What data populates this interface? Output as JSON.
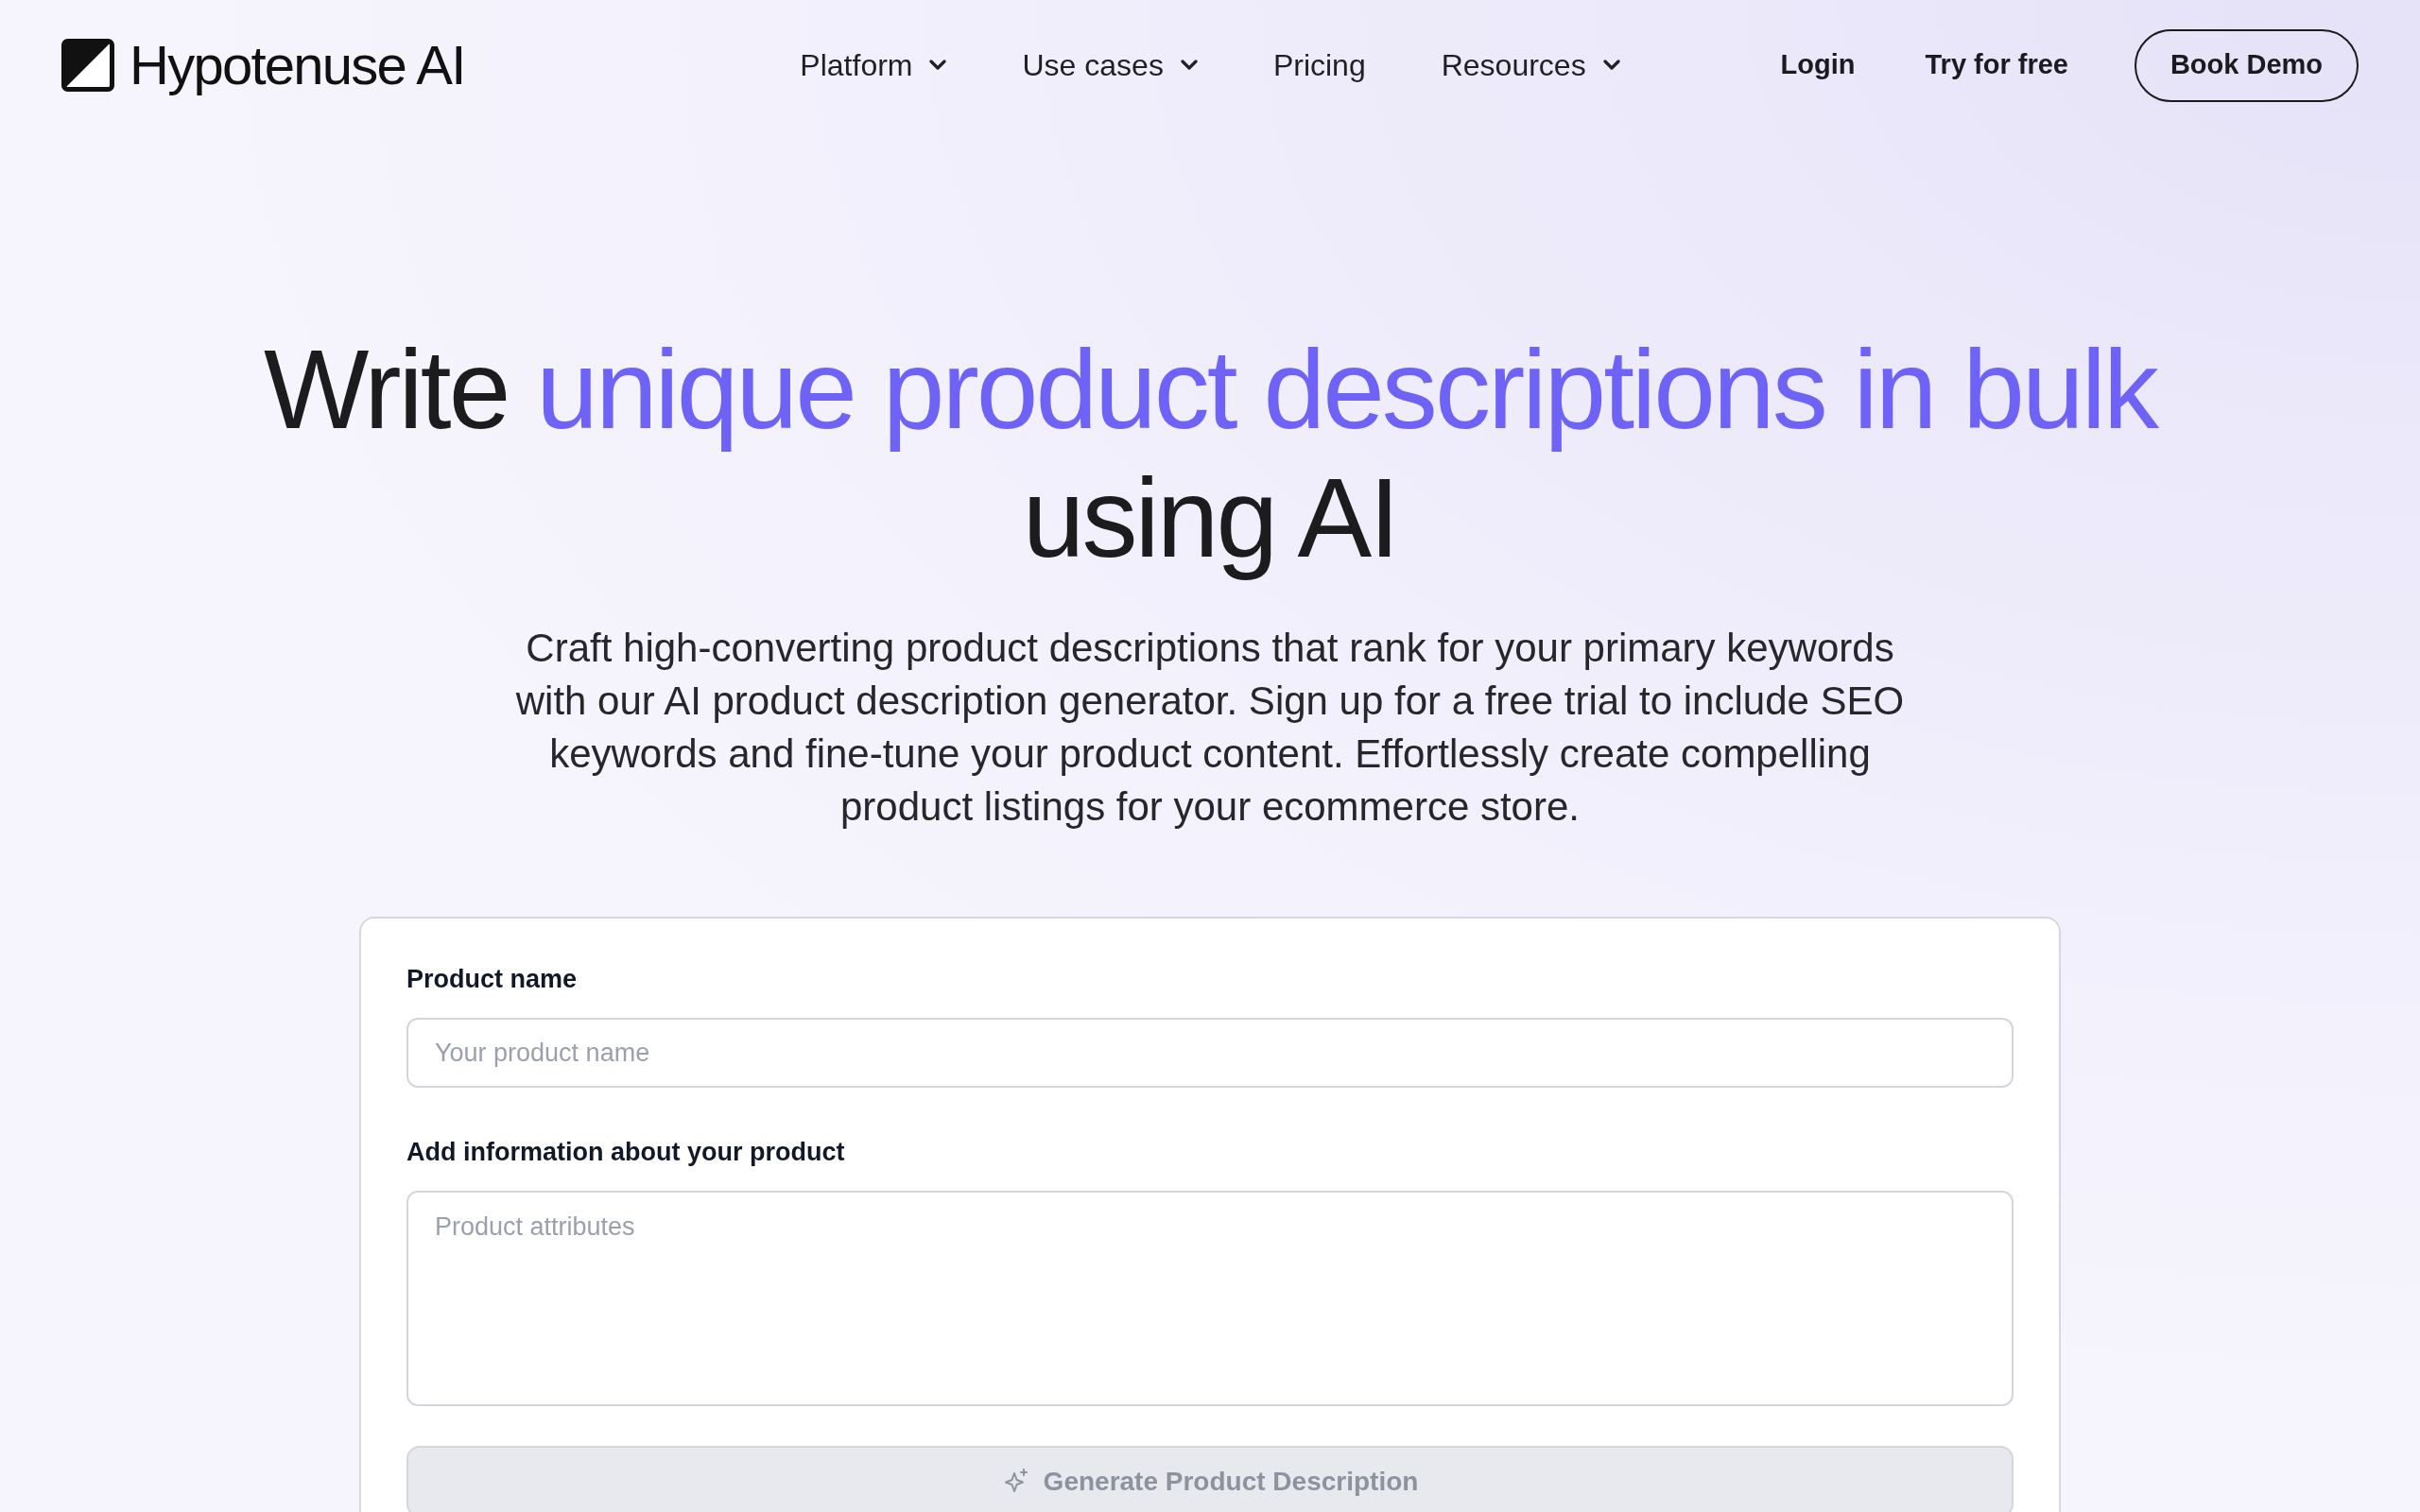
{
  "header": {
    "logo": {
      "text": "Hypotenuse AI"
    },
    "nav": [
      {
        "label": "Platform",
        "has_menu": true
      },
      {
        "label": "Use cases",
        "has_menu": true
      },
      {
        "label": "Pricing",
        "has_menu": false
      },
      {
        "label": "Resources",
        "has_menu": true
      }
    ],
    "links": [
      {
        "label": "Login"
      },
      {
        "label": "Try for free"
      }
    ],
    "cta": {
      "label": "Book Demo"
    }
  },
  "hero": {
    "title": [
      {
        "text": "Write",
        "highlight": false
      },
      {
        "text": "unique product descriptions in bulk",
        "highlight": true
      },
      {
        "text": "using AI",
        "highlight": false
      }
    ],
    "description": "Craft high-converting product descriptions that rank for your primary keywords with our AI product description generator. Sign up for a free trial to include SEO keywords and fine-tune your product content. Effortlessly create compelling product listings for your ecommerce store."
  },
  "form": {
    "fields": [
      {
        "kind": "input",
        "label": "Product name",
        "placeholder": "Your product name"
      },
      {
        "kind": "textarea",
        "label": "Add information about your product",
        "placeholder": "Product attributes"
      }
    ],
    "submit": {
      "label": "Generate Product Description",
      "disabled": true
    }
  }
}
